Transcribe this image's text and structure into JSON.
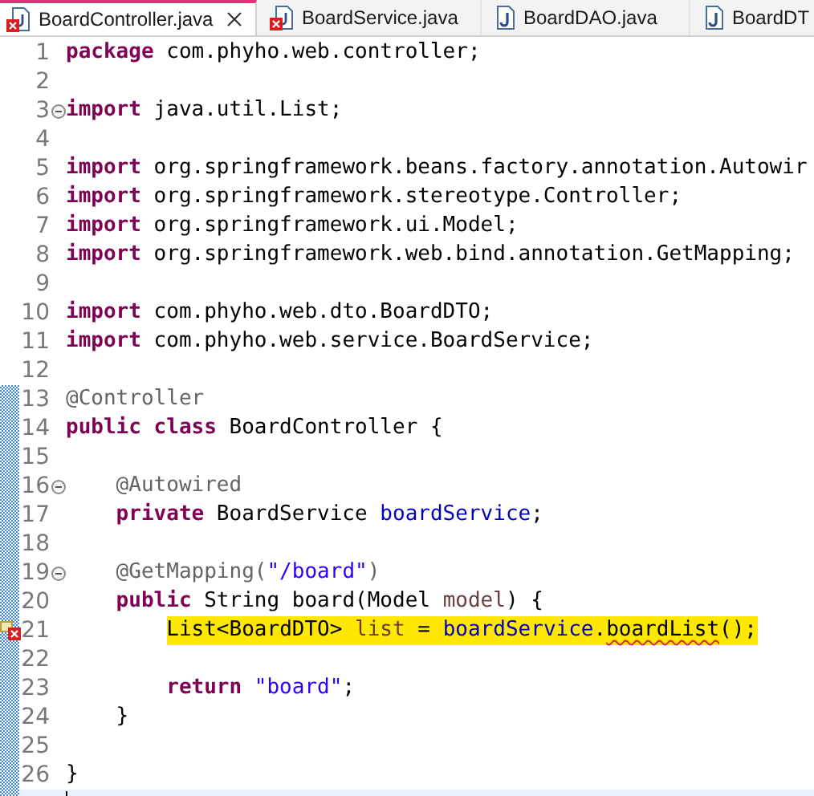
{
  "tabs": [
    {
      "label": "BoardController.java",
      "selected": true,
      "kind": "error",
      "closable": true
    },
    {
      "label": "BoardService.java",
      "selected": false,
      "kind": "error",
      "closable": false
    },
    {
      "label": "BoardDAO.java",
      "selected": false,
      "kind": "java",
      "closable": false
    },
    {
      "label": "BoardDT",
      "selected": false,
      "kind": "java",
      "closable": false
    }
  ],
  "lines": [
    {
      "number": "1",
      "fold": false,
      "changed": false,
      "error": false,
      "current": false,
      "tokens": [
        {
          "text": "package",
          "kind": "keyword"
        },
        {
          "text": " com.phyho.web.controller;",
          "kind": "plain"
        }
      ]
    },
    {
      "number": "2",
      "fold": false,
      "changed": false,
      "error": false,
      "current": false
    },
    {
      "number": "3",
      "fold": true,
      "changed": false,
      "error": false,
      "current": false,
      "tokens": [
        {
          "text": "import",
          "kind": "keyword"
        },
        {
          "text": " java.util.List;",
          "kind": "plain"
        }
      ]
    },
    {
      "number": "4",
      "fold": false,
      "changed": false,
      "error": false,
      "current": false
    },
    {
      "number": "5",
      "fold": false,
      "changed": false,
      "error": false,
      "current": false,
      "tokens": [
        {
          "text": "import",
          "kind": "keyword"
        },
        {
          "text": " org.springframework.beans.factory.annotation.Autowir",
          "kind": "plain"
        }
      ]
    },
    {
      "number": "6",
      "fold": false,
      "changed": false,
      "error": false,
      "current": false,
      "tokens": [
        {
          "text": "import",
          "kind": "keyword"
        },
        {
          "text": " org.springframework.stereotype.Controller;",
          "kind": "plain"
        }
      ]
    },
    {
      "number": "7",
      "fold": false,
      "changed": false,
      "error": false,
      "current": false,
      "tokens": [
        {
          "text": "import",
          "kind": "keyword"
        },
        {
          "text": " org.springframework.ui.Model;",
          "kind": "plain"
        }
      ]
    },
    {
      "number": "8",
      "fold": false,
      "changed": false,
      "error": false,
      "current": false,
      "tokens": [
        {
          "text": "import",
          "kind": "keyword"
        },
        {
          "text": " org.springframework.web.bind.annotation.GetMapping;",
          "kind": "plain"
        }
      ]
    },
    {
      "number": "9",
      "fold": false,
      "changed": false,
      "error": false,
      "current": false
    },
    {
      "number": "10",
      "fold": false,
      "changed": false,
      "error": false,
      "current": false,
      "tokens": [
        {
          "text": "import",
          "kind": "keyword"
        },
        {
          "text": " com.phyho.web.dto.BoardDTO;",
          "kind": "plain"
        }
      ]
    },
    {
      "number": "11",
      "fold": false,
      "changed": false,
      "error": false,
      "current": false,
      "tokens": [
        {
          "text": "import",
          "kind": "keyword"
        },
        {
          "text": " com.phyho.web.service.BoardService;",
          "kind": "plain"
        }
      ]
    },
    {
      "number": "12",
      "fold": false,
      "changed": false,
      "error": false,
      "current": false
    },
    {
      "number": "13",
      "fold": false,
      "changed": true,
      "error": false,
      "current": false,
      "tokens": [
        {
          "text": "@Controller",
          "kind": "annotation"
        }
      ]
    },
    {
      "number": "14",
      "fold": false,
      "changed": true,
      "error": false,
      "current": false,
      "tokens": [
        {
          "text": "public class",
          "kind": "keyword"
        },
        {
          "text": " BoardController {",
          "kind": "plain"
        }
      ]
    },
    {
      "number": "15",
      "fold": false,
      "changed": true,
      "error": false,
      "current": false
    },
    {
      "number": "16",
      "fold": true,
      "changed": true,
      "error": false,
      "current": false,
      "tokens": [
        {
          "text": "    @Autowired",
          "kind": "annotation"
        }
      ]
    },
    {
      "number": "17",
      "fold": false,
      "changed": true,
      "error": false,
      "current": false,
      "tokens": [
        {
          "text": "    private",
          "kind": "keyword"
        },
        {
          "text": " BoardService ",
          "kind": "plain"
        },
        {
          "text": "boardService",
          "kind": "field"
        },
        {
          "text": ";",
          "kind": "plain"
        }
      ]
    },
    {
      "number": "18",
      "fold": false,
      "changed": true,
      "error": false,
      "current": false
    },
    {
      "number": "19",
      "fold": true,
      "changed": true,
      "error": false,
      "current": false,
      "tokens": [
        {
          "text": "    @GetMapping(",
          "kind": "annotation"
        },
        {
          "text": "\"/board\"",
          "kind": "string"
        },
        {
          "text": ")",
          "kind": "annotation"
        }
      ]
    },
    {
      "number": "20",
      "fold": false,
      "changed": true,
      "error": false,
      "current": false,
      "tokens": [
        {
          "text": "    public",
          "kind": "keyword"
        },
        {
          "text": " String board(Model ",
          "kind": "plain"
        },
        {
          "text": "model",
          "kind": "local"
        },
        {
          "text": ") {",
          "kind": "plain"
        }
      ]
    },
    {
      "number": "21",
      "fold": false,
      "changed": true,
      "error": true,
      "current": false,
      "tokens": [
        {
          "text": "        List<BoardDTO> ",
          "kind": "plain",
          "highlighted": true
        },
        {
          "text": "list",
          "kind": "local",
          "highlighted": true
        },
        {
          "text": " = ",
          "kind": "plain",
          "highlighted": true
        },
        {
          "text": "boardService",
          "kind": "field",
          "highlighted": true
        },
        {
          "text": ".",
          "kind": "plain",
          "highlighted": true
        },
        {
          "text": "boardList",
          "kind": "plain",
          "highlighted": true,
          "error": true
        },
        {
          "text": "();",
          "kind": "plain",
          "highlighted": true
        }
      ]
    },
    {
      "number": "22",
      "fold": false,
      "changed": true,
      "error": false,
      "current": false
    },
    {
      "number": "23",
      "fold": false,
      "changed": true,
      "error": false,
      "current": false,
      "tokens": [
        {
          "text": "        return",
          "kind": "keyword"
        },
        {
          "text": " \"board\"",
          "kind": "string"
        },
        {
          "text": ";",
          "kind": "plain"
        }
      ]
    },
    {
      "number": "24",
      "fold": false,
      "changed": true,
      "error": false,
      "current": false,
      "tokens": [
        {
          "text": "    }",
          "kind": "plain"
        }
      ]
    },
    {
      "number": "25",
      "fold": false,
      "changed": true,
      "error": false,
      "current": false
    },
    {
      "number": "26",
      "fold": false,
      "changed": true,
      "error": false,
      "current": false,
      "tokens": [
        {
          "text": "}",
          "kind": "plain"
        }
      ]
    },
    {
      "fold": false,
      "changed": true,
      "error": false,
      "current": true
    }
  ]
}
